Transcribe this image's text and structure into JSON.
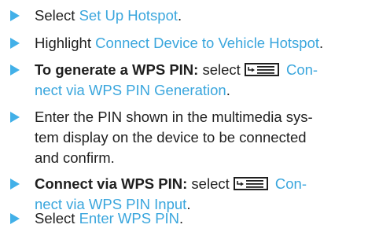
{
  "steps": [
    {
      "text": "Select",
      "link": "Set Up Hotspot",
      "tail": "."
    },
    {
      "text": "Highlight",
      "link": "Connect Device to Vehicle Hotspot",
      "tail": "."
    },
    {
      "bold": "To generate a WPS PIN:",
      "text": " select ",
      "link_line1": "Con-",
      "link_line2": "nect via WPS PIN Generation",
      "tail": ".",
      "icon": "menu-icon"
    },
    {
      "line1": "Enter the PIN shown in the multimedia sys-",
      "line2": "tem display on the device to be connected",
      "line3": "and confirm."
    },
    {
      "bold": "Connect via WPS PIN:",
      "text": " select ",
      "link_line1": "Con-",
      "link_line2": "nect via WPS PIN Input",
      "tail": ".",
      "icon": "menu-icon"
    },
    {
      "text": "Select",
      "link": "Enter WPS PIN",
      "tail": "."
    }
  ],
  "colors": {
    "arrow": "#42b0e8",
    "link": "#3aa6dd",
    "text": "#1f1f1f"
  }
}
